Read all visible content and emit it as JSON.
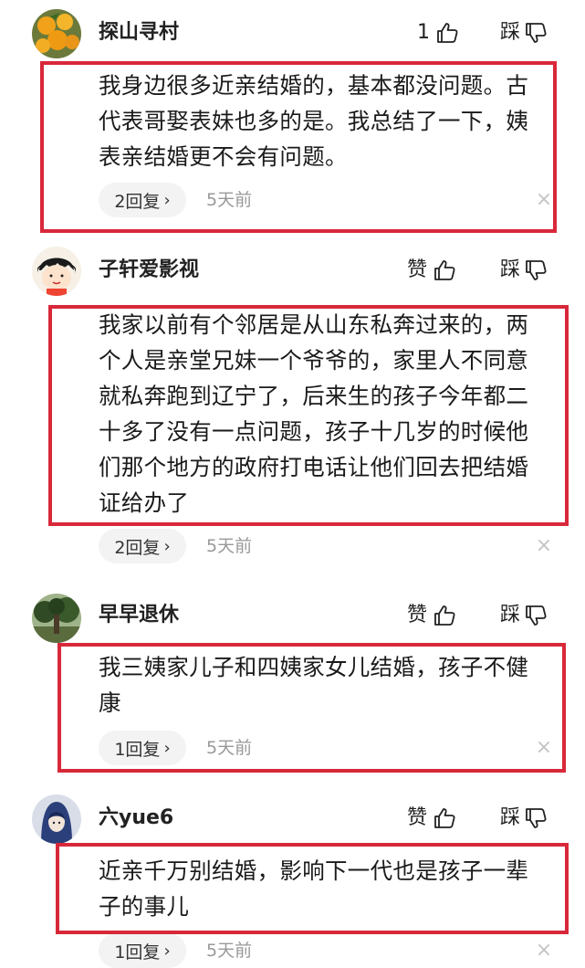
{
  "comments": [
    {
      "username": "探山寻村",
      "like_label": "1",
      "dislike_label": "踩",
      "text": "我身边很多近亲结婚的，基本都没问题。古代表哥娶表妹也多的是。我总结了一下，姨表亲结婚更不会有问题。",
      "reply_label": "2回复",
      "time": "5天前",
      "avatar": "orange-fruit-avatar"
    },
    {
      "username": "子轩爱影视",
      "like_label": "赞",
      "dislike_label": "踩",
      "text": "我家以前有个邻居是从山东私奔过来的，两个人是亲堂兄妹一个爷爷的，家里人不同意就私奔跑到辽宁了，后来生的孩子今年都二十多了没有一点问题，孩子十几岁的时候他们那个地方的政府打电话让他们回去把结婚证给办了",
      "reply_label": "2回复",
      "time": "5天前",
      "avatar": "cartoon-girl-avatar"
    },
    {
      "username": "早早退休",
      "like_label": "赞",
      "dislike_label": "踩",
      "text": "我三姨家儿子和四姨家女儿结婚，孩子不健康",
      "reply_label": "1回复",
      "time": "5天前",
      "avatar": "tree-landscape-avatar"
    },
    {
      "username": "六yue6",
      "like_label": "赞",
      "dislike_label": "踩",
      "text": "近亲千万别结婚，影响下一代也是孩子一辈子的事儿",
      "reply_label": "1回复",
      "time": "5天前",
      "avatar": "hooded-figure-avatar"
    }
  ],
  "colors": {
    "highlight_border": "#d8283a",
    "pill_bg": "#f3f3f3",
    "muted_text": "#999999"
  }
}
